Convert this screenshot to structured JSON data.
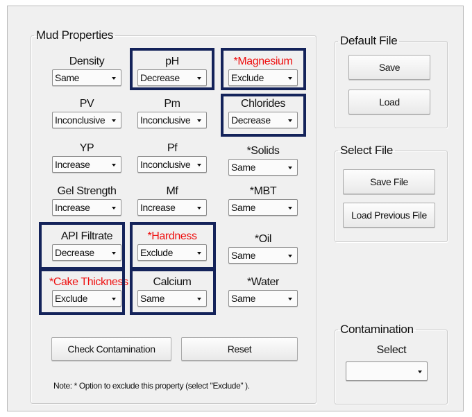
{
  "mud_properties": {
    "title": "Mud Properties",
    "properties": [
      {
        "label": "Density",
        "value": "Same"
      },
      {
        "label": "pH",
        "value": "Decrease"
      },
      {
        "label": "*Magnesium",
        "value": "Exclude"
      },
      {
        "label": "PV",
        "value": "Inconclusive"
      },
      {
        "label": "Pm",
        "value": "Inconclusive"
      },
      {
        "label": "Chlorides",
        "value": "Decrease"
      },
      {
        "label": "YP",
        "value": "Increase"
      },
      {
        "label": "Pf",
        "value": "Inconclusive"
      },
      {
        "label": "*Solids",
        "value": "Same"
      },
      {
        "label": "Gel Strength",
        "value": "Increase"
      },
      {
        "label": "Mf",
        "value": "Increase"
      },
      {
        "label": "*MBT",
        "value": "Same"
      },
      {
        "label": "API Filtrate",
        "value": "Decrease"
      },
      {
        "label": "*Hardness",
        "value": "Exclude"
      },
      {
        "label": "*Oil",
        "value": "Same"
      },
      {
        "label": "*Cake Thickness",
        "value": "Exclude"
      },
      {
        "label": "Calcium",
        "value": "Same"
      },
      {
        "label": "*Water",
        "value": "Same"
      }
    ],
    "check_button": "Check Contamination",
    "reset_button": "Reset",
    "note": "Note: * Option to exclude this property (select \"Exclude\" )."
  },
  "default_file": {
    "title": "Default File",
    "save_button": "Save",
    "load_button": "Load"
  },
  "select_file": {
    "title": "Select File",
    "save_button": "Save File",
    "load_button": "Load Previous File"
  },
  "contamination": {
    "title": "Contamination",
    "select_label": "Select",
    "select_value": ""
  },
  "colors": {
    "highlight_border": "#14235a",
    "excluded_label": "#ee1111",
    "panel_background": "#f0f0f0"
  }
}
